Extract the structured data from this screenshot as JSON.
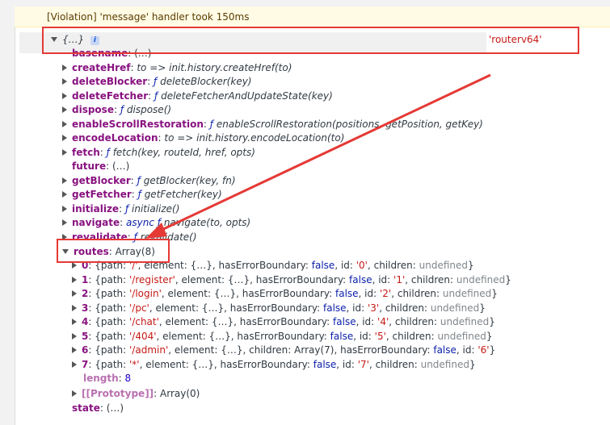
{
  "violation": "[Violation] 'message' handler took 150ms",
  "object_header": {
    "preview": "{…}",
    "info_icon": "i",
    "tag": "'routerv64'"
  },
  "properties": [
    {
      "key": "basename",
      "value": "(…)",
      "expandable": false
    },
    {
      "key": "createHref",
      "value": "to => init.history.createHref(to)",
      "expandable": true
    },
    {
      "key": "deleteBlocker",
      "fsym": "ƒ",
      "value": "deleteBlocker(key)",
      "expandable": true
    },
    {
      "key": "deleteFetcher",
      "fsym": "ƒ",
      "value": "deleteFetcherAndUpdateState(key)",
      "expandable": true
    },
    {
      "key": "dispose",
      "fsym": "ƒ",
      "value": "dispose()",
      "expandable": true
    },
    {
      "key": "enableScrollRestoration",
      "fsym": "ƒ",
      "value": "enableScrollRestoration(positions, getPosition, getKey)",
      "expandable": true
    },
    {
      "key": "encodeLocation",
      "value": "to => init.history.encodeLocation(to)",
      "expandable": true
    },
    {
      "key": "fetch",
      "fsym": "ƒ",
      "value": "fetch(key, routeId, href, opts)",
      "expandable": true
    },
    {
      "key": "future",
      "value": "(…)",
      "expandable": false
    },
    {
      "key": "getBlocker",
      "fsym": "ƒ",
      "value": "getBlocker(key, fn)",
      "expandable": true
    },
    {
      "key": "getFetcher",
      "fsym": "ƒ",
      "value": "getFetcher(key)",
      "expandable": true
    },
    {
      "key": "initialize",
      "fsym": "ƒ",
      "value": "initialize()",
      "expandable": true
    },
    {
      "key": "navigate",
      "async": "async",
      "fsym": "ƒ",
      "value": "navigate(to, opts)",
      "expandable": true
    },
    {
      "key": "revalidate",
      "fsym": "ƒ",
      "value": "revalidate()",
      "expandable": true
    }
  ],
  "routes": {
    "key": "routes",
    "value": "Array(8)",
    "items": [
      {
        "index": "0",
        "path": "'/'",
        "children": "undefined",
        "id": "'0'",
        "variant": "standard"
      },
      {
        "index": "1",
        "path": "'/register'",
        "children": "undefined",
        "id": "'1'",
        "variant": "standard"
      },
      {
        "index": "2",
        "path": "'/login'",
        "children": "undefined",
        "id": "'2'",
        "variant": "standard"
      },
      {
        "index": "3",
        "path": "'/pc'",
        "children": "undefined",
        "id": "'3'",
        "variant": "standard"
      },
      {
        "index": "4",
        "path": "'/chat'",
        "children": "undefined",
        "id": "'4'",
        "variant": "standard"
      },
      {
        "index": "5",
        "path": "'/404'",
        "children": "undefined",
        "id": "'5'",
        "variant": "standard"
      },
      {
        "index": "6",
        "path": "'/admin'",
        "children": "Array(7)",
        "id": "'6'",
        "variant": "admin"
      },
      {
        "index": "7",
        "path": "'*'",
        "children": "undefined",
        "id": "'7'",
        "variant": "standard"
      }
    ],
    "length_key": "length",
    "length_value": "8",
    "prototype_key": "[[Prototype]]",
    "prototype_value": "Array(0)"
  },
  "state": {
    "key": "state",
    "value": "(…)"
  },
  "tokens": {
    "element_key": "element",
    "element_value": "{…}",
    "heb_key": "hasErrorBoundary",
    "heb_value": "false",
    "id_key": "id",
    "children_key": "children",
    "path_key": "path"
  },
  "colors": {
    "annotation": "#e53935",
    "key": "#881280",
    "string": "#c41a16",
    "number": "#1c00cf"
  }
}
